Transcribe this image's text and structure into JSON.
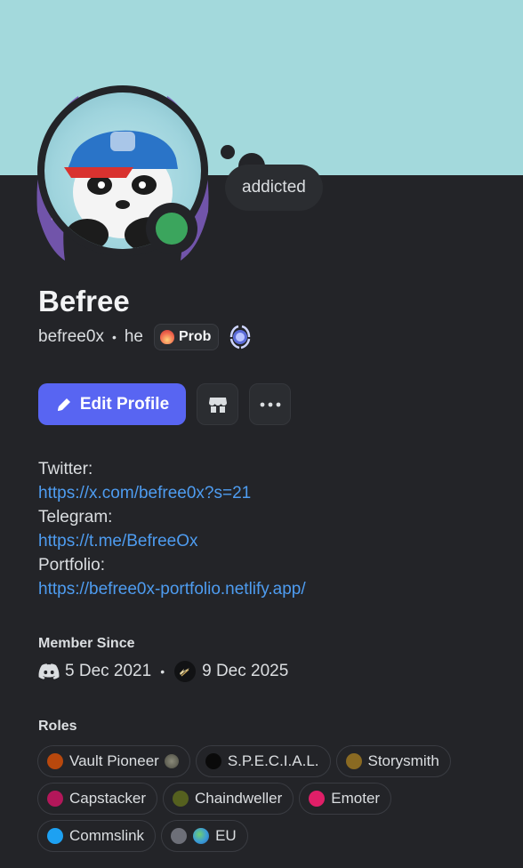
{
  "profile": {
    "display_name": "Befree",
    "username": "befree0x",
    "pronouns": "he",
    "separator": "•",
    "guild_tag": "Prob",
    "custom_status": "addicted",
    "status": "online"
  },
  "actions": {
    "edit_profile_label": "Edit Profile"
  },
  "bio": [
    {
      "label": "Twitter:",
      "link": "https://x.com/befree0x?s=21"
    },
    {
      "label": "Telegram:",
      "link": "https://t.me/BefreeOx"
    },
    {
      "label": "Portfolio:",
      "link": "https://befree0x-portfolio.netlify.app/"
    }
  ],
  "member_since": {
    "title": "Member Since",
    "discord_date": "5 Dec 2021",
    "server_date": "9 Dec 2025"
  },
  "roles": {
    "title": "Roles",
    "items": [
      {
        "name": "Vault Pioneer",
        "color": "#b8480d"
      },
      {
        "name": "S.P.E.C.I.A.L.",
        "color": "#0a0a0a"
      },
      {
        "name": "Storysmith",
        "color": "#8a6a22"
      },
      {
        "name": "Capstacker",
        "color": "#b3175a"
      },
      {
        "name": "Chaindweller",
        "color": "#55601f"
      },
      {
        "name": "Emoter",
        "color": "#e01f68"
      },
      {
        "name": "Commslink",
        "color": "#1da1f2"
      },
      {
        "name": "EU",
        "color": "#6d6f78"
      }
    ]
  },
  "colors": {
    "banner": "#a3d9dc",
    "background": "#232428",
    "accent": "#5865f2",
    "link": "#4e9cf0",
    "online": "#3ba55d"
  }
}
